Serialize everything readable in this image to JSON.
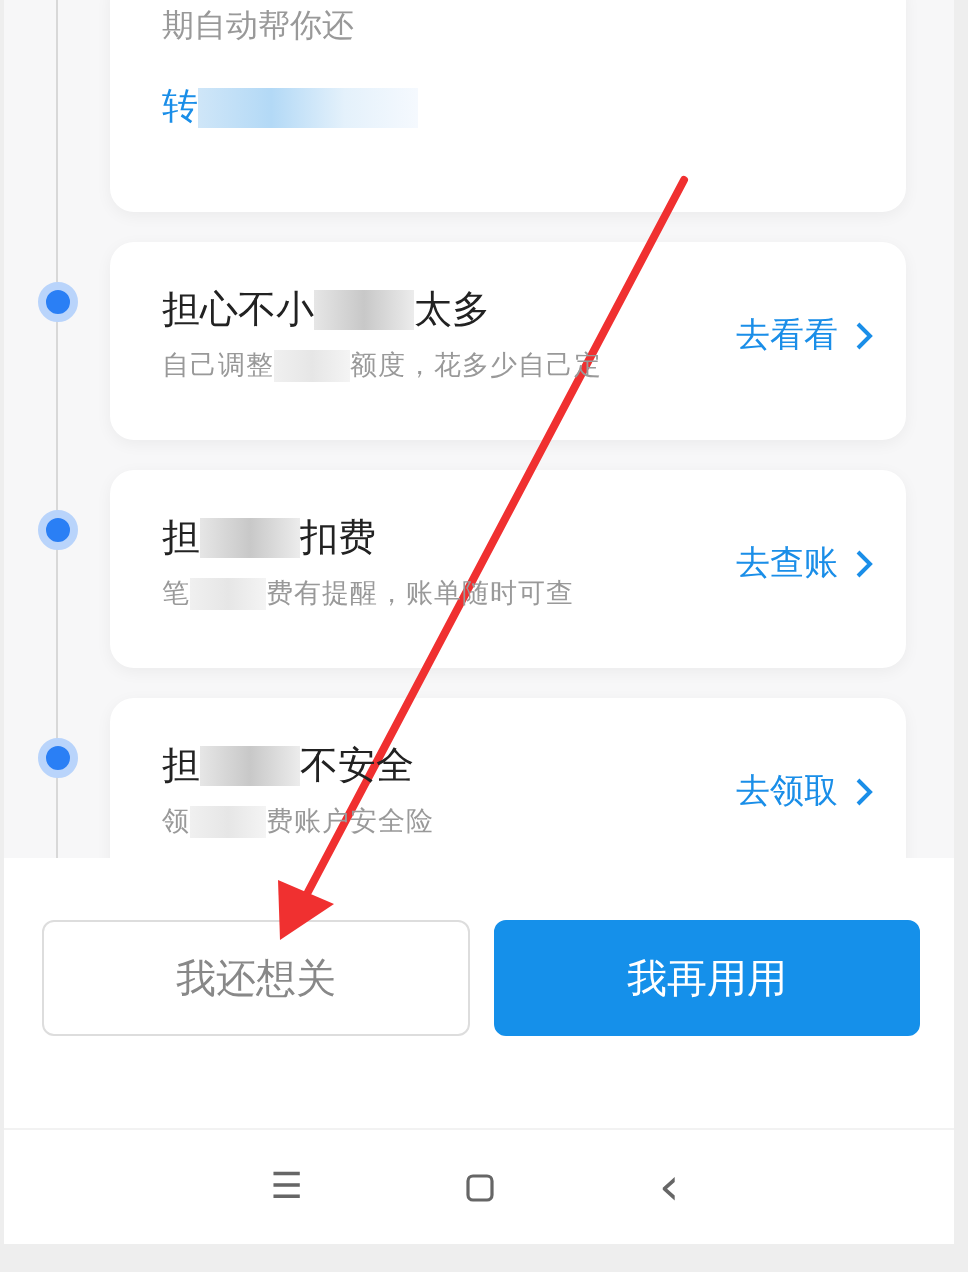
{
  "top_card": {
    "text": "期自动帮你还",
    "link": [
      "转"
    ]
  },
  "items": [
    {
      "title": [
        "担心不小",
        "太多"
      ],
      "subtitle": [
        "自己调整",
        "额度，花多少自己定"
      ],
      "action": "去看看",
      "active": true
    },
    {
      "title": [
        "担",
        "扣费"
      ],
      "subtitle": [
        "笔",
        "费有提醒，账单随时可查"
      ],
      "action": "去查账",
      "active": true
    },
    {
      "title": [
        "担",
        "不安全"
      ],
      "subtitle": [
        "领",
        "费账户安全险"
      ],
      "action": "去领取",
      "active": true
    }
  ],
  "buttons": [
    {
      "label": "我还想关",
      "kind": "secondary"
    },
    {
      "label": "我再用用",
      "kind": "primary"
    }
  ],
  "nav_bar": {
    "menu": "☰",
    "back": "‹"
  }
}
